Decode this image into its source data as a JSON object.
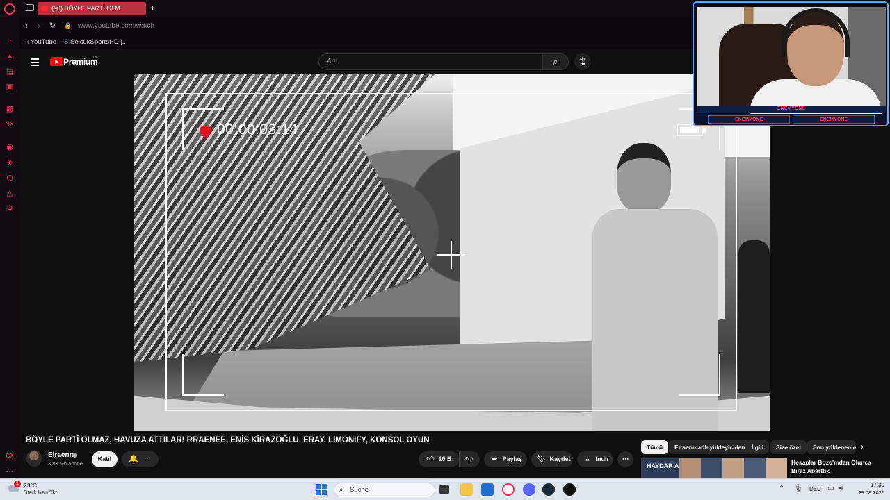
{
  "browser": {
    "tab_title": "(90) BÖYLE PARTİ OLM",
    "new_tab_symbol": "+",
    "url": "www.youtube.com/watch",
    "bookmarks": [
      "YouTube",
      "SelcukSportsHD |..."
    ]
  },
  "youtube": {
    "brand": "Premium",
    "region": "DE",
    "search_placeholder": "Ara",
    "video": {
      "rec_time": "00:00:03:14",
      "title": "BÖYLE PARTİ OLMAZ, HAVUZA ATTILAR! RRAENEE, ENİS KİRAZOĞLU, ERAY, LIMONIFY, KONSOL OYUN",
      "channel": "Elraenn",
      "subscribers": "3,83 Mn abone",
      "join_label": "Katıl",
      "likes": "10 B",
      "share_label": "Paylaş",
      "save_label": "Kaydet",
      "download_label": "İndir"
    },
    "chips": [
      "Tümü",
      "Elraenn adlı yükleyiciden",
      "İlgili",
      "Size özel",
      "Son yüklenenler"
    ],
    "recommendation": {
      "thumb_text": "HAYDAR AL",
      "title": "Hesaplar Bozo'mdan Olunca Biraz Abarttık"
    }
  },
  "webcam": {
    "banner": "ENEMYONE",
    "tag_left": "ENEMYONE",
    "tag_right": "ENEMYONE"
  },
  "taskbar": {
    "weather_temp": "23°C",
    "weather_desc": "Stark bewölkt",
    "weather_badge": "1",
    "search_label": "Suche",
    "language": "DEU",
    "time": "17:30",
    "date": "29.08.2026"
  },
  "colors": {
    "accent_gx": "#e8344b",
    "youtube_red": "#ff0000",
    "rec_red": "#e0141e",
    "webcam_border": "#5aa7ff"
  }
}
